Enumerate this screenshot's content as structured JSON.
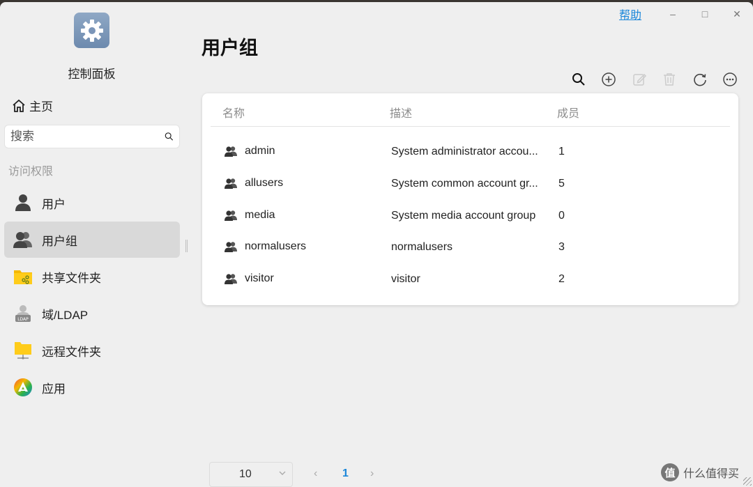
{
  "window": {
    "help_label": "帮助",
    "minimize_symbol": "–",
    "maximize_symbol": "□",
    "close_symbol": "✕"
  },
  "sidebar": {
    "app_title": "控制面板",
    "app_icon": "gear-icon",
    "home_label": "主页",
    "search_placeholder": "搜索",
    "section_title": "访问权限",
    "items": [
      {
        "label": "用户",
        "icon": "user-icon",
        "active": false
      },
      {
        "label": "用户组",
        "icon": "user-group-icon",
        "active": true
      },
      {
        "label": "共享文件夹",
        "icon": "shared-folder-icon",
        "active": false
      },
      {
        "label": "域/LDAP",
        "icon": "ldap-icon",
        "active": false
      },
      {
        "label": "远程文件夹",
        "icon": "remote-folder-icon",
        "active": false
      },
      {
        "label": "应用",
        "icon": "app-icon",
        "active": false
      }
    ]
  },
  "main": {
    "title": "用户组",
    "toolbar": [
      "search-icon",
      "add-icon",
      "edit-icon",
      "delete-icon",
      "refresh-icon",
      "more-icon"
    ],
    "table": {
      "columns": [
        "名称",
        "描述",
        "成员"
      ],
      "rows": [
        {
          "name": "admin",
          "description": "System administrator accou...",
          "members": "1"
        },
        {
          "name": "allusers",
          "description": "System common account gr...",
          "members": "5"
        },
        {
          "name": "media",
          "description": "System media account group",
          "members": "0"
        },
        {
          "name": "normalusers",
          "description": "normalusers",
          "members": "3"
        },
        {
          "name": "visitor",
          "description": "visitor",
          "members": "2"
        }
      ]
    },
    "pagination": {
      "page_size": "10",
      "prev_symbol": "‹",
      "current_page": "1",
      "next_symbol": "›"
    }
  },
  "watermark": {
    "logo_char": "值",
    "text": "什么值得买"
  },
  "colors": {
    "accent": "#1a86d9",
    "active_nav_bg": "#d9d9d9",
    "window_bg": "#efefef"
  }
}
